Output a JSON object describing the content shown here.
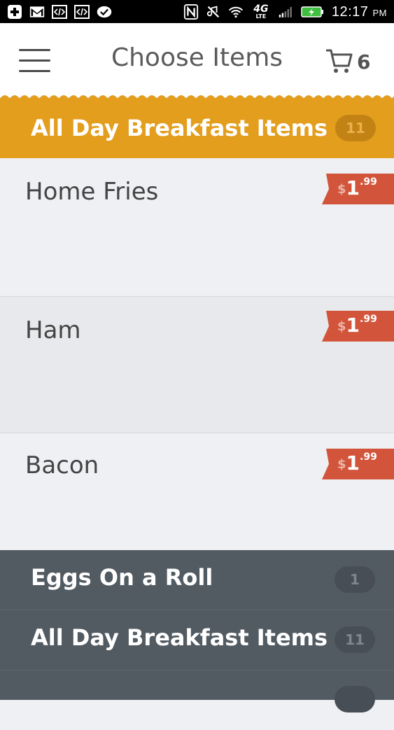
{
  "status_bar": {
    "time": "12:17",
    "ampm": "PM",
    "network": "4G",
    "network_sub": "LTE",
    "left_icons": [
      "add-icon",
      "mail-icon",
      "code-icon",
      "code-icon",
      "check-icon"
    ],
    "right_icons": [
      "nfc-icon",
      "mute-icon",
      "wifi-icon",
      "signal-icon",
      "battery-icon"
    ]
  },
  "appbar": {
    "title": "Choose Items",
    "cart_count": "6"
  },
  "category": {
    "title": "All Day Breakfast Items",
    "count": "11"
  },
  "items": [
    {
      "name": "Home Fries",
      "currency": "$",
      "dollars": "1",
      "cents": ".99"
    },
    {
      "name": "Ham",
      "currency": "$",
      "dollars": "1",
      "cents": ".99"
    },
    {
      "name": "Bacon",
      "currency": "$",
      "dollars": "1",
      "cents": ".99"
    }
  ],
  "other_categories": [
    {
      "title": "Eggs On a Roll",
      "count": "1"
    },
    {
      "title": "All Day Breakfast Items",
      "count": "11"
    }
  ],
  "colors": {
    "accent": "#e39e1e",
    "price_tag": "#d2553b",
    "drawer": "#525a62",
    "item_bg": "#eef0f3"
  }
}
